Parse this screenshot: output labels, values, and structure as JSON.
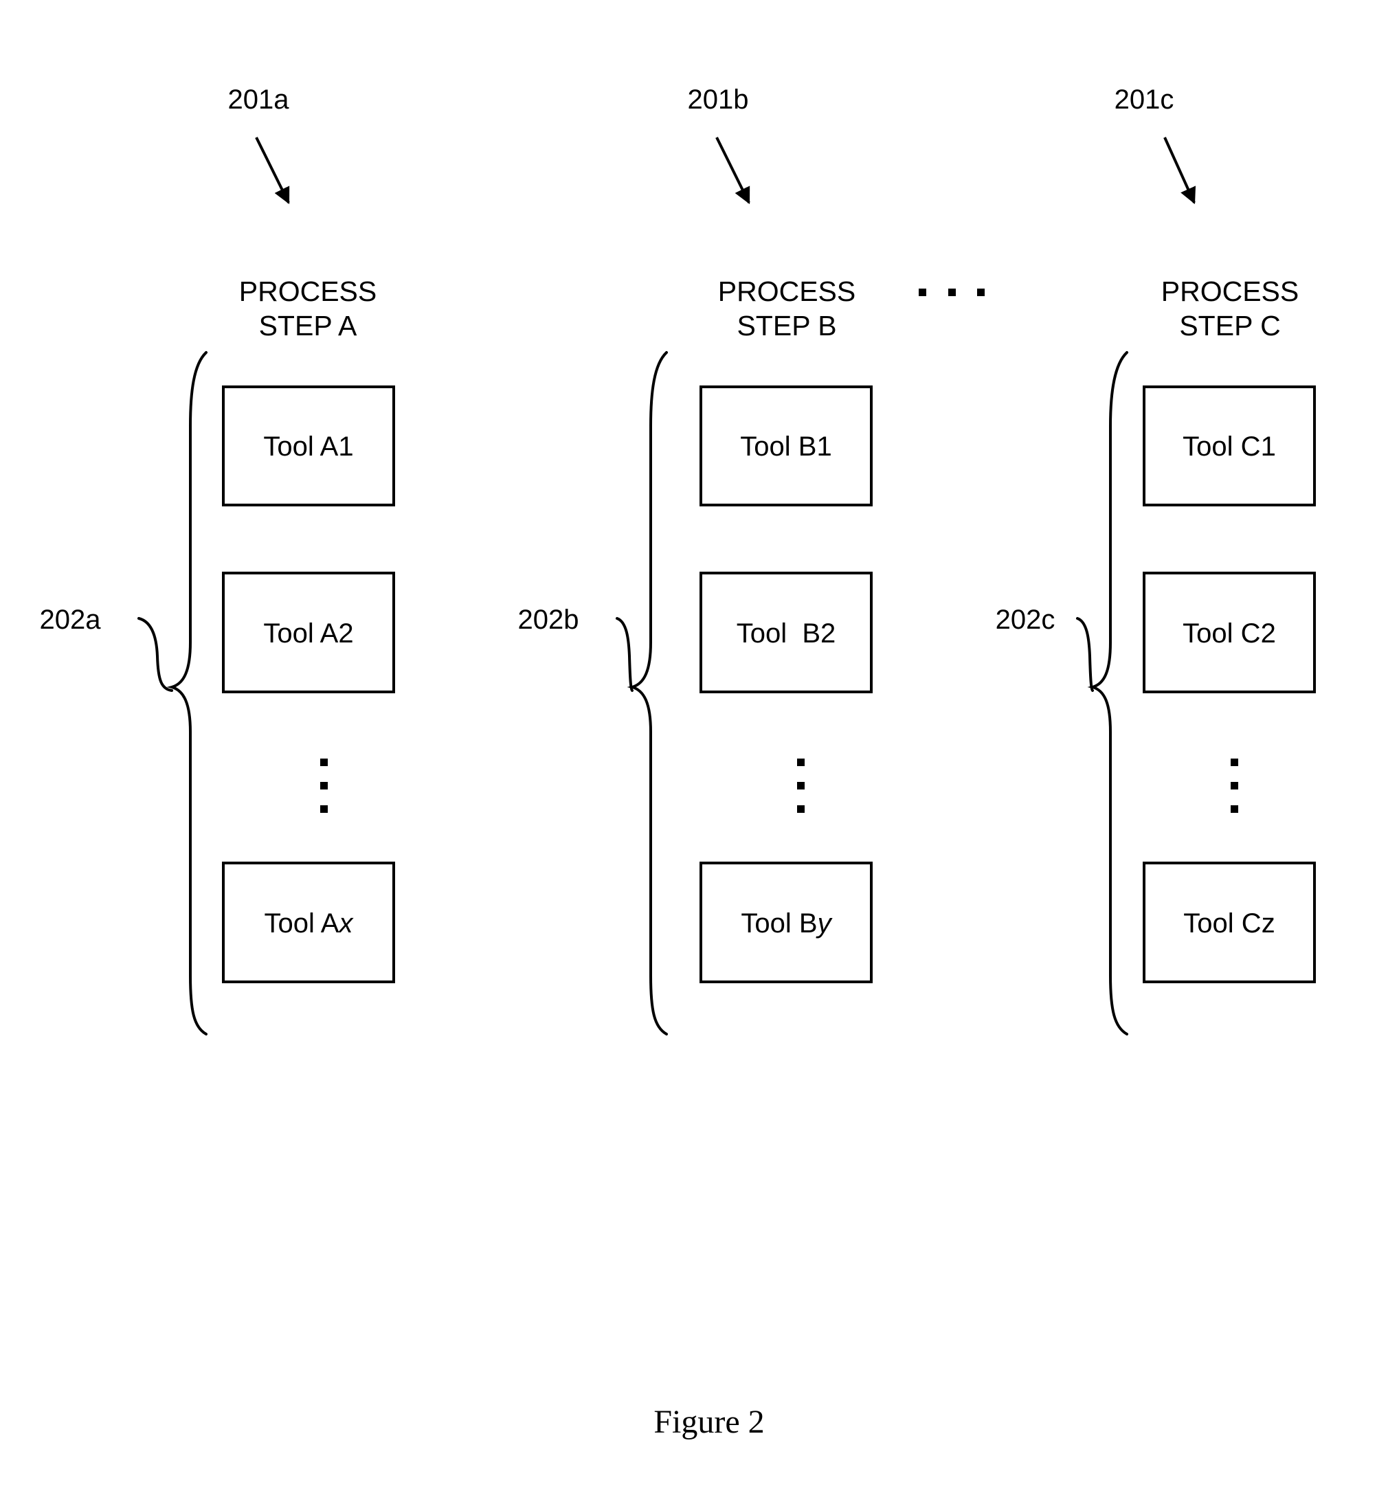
{
  "figure": {
    "caption": "Figure 2",
    "ellipsis_between_steps": "…"
  },
  "columns": [
    {
      "id": "a",
      "ref_label": "201a",
      "group_label": "202a",
      "title_line1": "PROCESS",
      "title_line2": "STEP A",
      "tools": [
        {
          "prefix": "Tool A",
          "suffix": "1",
          "italic_suffix": false
        },
        {
          "prefix": "Tool A",
          "suffix": "2",
          "italic_suffix": false
        },
        {
          "prefix": "Tool A",
          "suffix": "x",
          "italic_suffix": true
        }
      ]
    },
    {
      "id": "b",
      "ref_label": "201b",
      "group_label": "202b",
      "title_line1": "PROCESS",
      "title_line2": "STEP B",
      "tools": [
        {
          "prefix": "Tool B",
          "suffix": "1",
          "italic_suffix": false
        },
        {
          "prefix": "Tool  B",
          "suffix": "2",
          "italic_suffix": false
        },
        {
          "prefix": "Tool B",
          "suffix": "y",
          "italic_suffix": true
        }
      ]
    },
    {
      "id": "c",
      "ref_label": "201c",
      "group_label": "202c",
      "title_line1": "PROCESS",
      "title_line2": "STEP C",
      "tools": [
        {
          "prefix": "Tool C",
          "suffix": "1",
          "italic_suffix": false
        },
        {
          "prefix": "Tool C",
          "suffix": "2",
          "italic_suffix": false
        },
        {
          "prefix": "Tool C",
          "suffix": "z",
          "italic_suffix": true
        }
      ]
    }
  ],
  "colors": {
    "ink": "#000000",
    "background": "#ffffff"
  }
}
